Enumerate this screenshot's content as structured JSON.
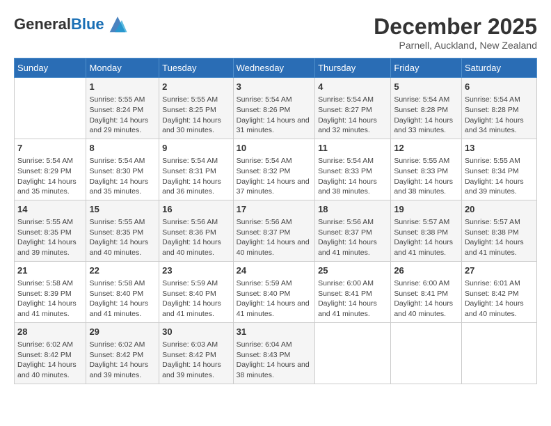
{
  "logo": {
    "general": "General",
    "blue": "Blue"
  },
  "title": {
    "month_year": "December 2025",
    "location": "Parnell, Auckland, New Zealand"
  },
  "days_header": [
    "Sunday",
    "Monday",
    "Tuesday",
    "Wednesday",
    "Thursday",
    "Friday",
    "Saturday"
  ],
  "weeks": [
    [
      {
        "day": "",
        "sunrise": "",
        "sunset": "",
        "daylight": ""
      },
      {
        "day": "1",
        "sunrise": "Sunrise: 5:55 AM",
        "sunset": "Sunset: 8:24 PM",
        "daylight": "Daylight: 14 hours and 29 minutes."
      },
      {
        "day": "2",
        "sunrise": "Sunrise: 5:55 AM",
        "sunset": "Sunset: 8:25 PM",
        "daylight": "Daylight: 14 hours and 30 minutes."
      },
      {
        "day": "3",
        "sunrise": "Sunrise: 5:54 AM",
        "sunset": "Sunset: 8:26 PM",
        "daylight": "Daylight: 14 hours and 31 minutes."
      },
      {
        "day": "4",
        "sunrise": "Sunrise: 5:54 AM",
        "sunset": "Sunset: 8:27 PM",
        "daylight": "Daylight: 14 hours and 32 minutes."
      },
      {
        "day": "5",
        "sunrise": "Sunrise: 5:54 AM",
        "sunset": "Sunset: 8:28 PM",
        "daylight": "Daylight: 14 hours and 33 minutes."
      },
      {
        "day": "6",
        "sunrise": "Sunrise: 5:54 AM",
        "sunset": "Sunset: 8:28 PM",
        "daylight": "Daylight: 14 hours and 34 minutes."
      }
    ],
    [
      {
        "day": "7",
        "sunrise": "Sunrise: 5:54 AM",
        "sunset": "Sunset: 8:29 PM",
        "daylight": "Daylight: 14 hours and 35 minutes."
      },
      {
        "day": "8",
        "sunrise": "Sunrise: 5:54 AM",
        "sunset": "Sunset: 8:30 PM",
        "daylight": "Daylight: 14 hours and 35 minutes."
      },
      {
        "day": "9",
        "sunrise": "Sunrise: 5:54 AM",
        "sunset": "Sunset: 8:31 PM",
        "daylight": "Daylight: 14 hours and 36 minutes."
      },
      {
        "day": "10",
        "sunrise": "Sunrise: 5:54 AM",
        "sunset": "Sunset: 8:32 PM",
        "daylight": "Daylight: 14 hours and 37 minutes."
      },
      {
        "day": "11",
        "sunrise": "Sunrise: 5:54 AM",
        "sunset": "Sunset: 8:33 PM",
        "daylight": "Daylight: 14 hours and 38 minutes."
      },
      {
        "day": "12",
        "sunrise": "Sunrise: 5:55 AM",
        "sunset": "Sunset: 8:33 PM",
        "daylight": "Daylight: 14 hours and 38 minutes."
      },
      {
        "day": "13",
        "sunrise": "Sunrise: 5:55 AM",
        "sunset": "Sunset: 8:34 PM",
        "daylight": "Daylight: 14 hours and 39 minutes."
      }
    ],
    [
      {
        "day": "14",
        "sunrise": "Sunrise: 5:55 AM",
        "sunset": "Sunset: 8:35 PM",
        "daylight": "Daylight: 14 hours and 39 minutes."
      },
      {
        "day": "15",
        "sunrise": "Sunrise: 5:55 AM",
        "sunset": "Sunset: 8:35 PM",
        "daylight": "Daylight: 14 hours and 40 minutes."
      },
      {
        "day": "16",
        "sunrise": "Sunrise: 5:56 AM",
        "sunset": "Sunset: 8:36 PM",
        "daylight": "Daylight: 14 hours and 40 minutes."
      },
      {
        "day": "17",
        "sunrise": "Sunrise: 5:56 AM",
        "sunset": "Sunset: 8:37 PM",
        "daylight": "Daylight: 14 hours and 40 minutes."
      },
      {
        "day": "18",
        "sunrise": "Sunrise: 5:56 AM",
        "sunset": "Sunset: 8:37 PM",
        "daylight": "Daylight: 14 hours and 41 minutes."
      },
      {
        "day": "19",
        "sunrise": "Sunrise: 5:57 AM",
        "sunset": "Sunset: 8:38 PM",
        "daylight": "Daylight: 14 hours and 41 minutes."
      },
      {
        "day": "20",
        "sunrise": "Sunrise: 5:57 AM",
        "sunset": "Sunset: 8:38 PM",
        "daylight": "Daylight: 14 hours and 41 minutes."
      }
    ],
    [
      {
        "day": "21",
        "sunrise": "Sunrise: 5:58 AM",
        "sunset": "Sunset: 8:39 PM",
        "daylight": "Daylight: 14 hours and 41 minutes."
      },
      {
        "day": "22",
        "sunrise": "Sunrise: 5:58 AM",
        "sunset": "Sunset: 8:40 PM",
        "daylight": "Daylight: 14 hours and 41 minutes."
      },
      {
        "day": "23",
        "sunrise": "Sunrise: 5:59 AM",
        "sunset": "Sunset: 8:40 PM",
        "daylight": "Daylight: 14 hours and 41 minutes."
      },
      {
        "day": "24",
        "sunrise": "Sunrise: 5:59 AM",
        "sunset": "Sunset: 8:40 PM",
        "daylight": "Daylight: 14 hours and 41 minutes."
      },
      {
        "day": "25",
        "sunrise": "Sunrise: 6:00 AM",
        "sunset": "Sunset: 8:41 PM",
        "daylight": "Daylight: 14 hours and 41 minutes."
      },
      {
        "day": "26",
        "sunrise": "Sunrise: 6:00 AM",
        "sunset": "Sunset: 8:41 PM",
        "daylight": "Daylight: 14 hours and 40 minutes."
      },
      {
        "day": "27",
        "sunrise": "Sunrise: 6:01 AM",
        "sunset": "Sunset: 8:42 PM",
        "daylight": "Daylight: 14 hours and 40 minutes."
      }
    ],
    [
      {
        "day": "28",
        "sunrise": "Sunrise: 6:02 AM",
        "sunset": "Sunset: 8:42 PM",
        "daylight": "Daylight: 14 hours and 40 minutes."
      },
      {
        "day": "29",
        "sunrise": "Sunrise: 6:02 AM",
        "sunset": "Sunset: 8:42 PM",
        "daylight": "Daylight: 14 hours and 39 minutes."
      },
      {
        "day": "30",
        "sunrise": "Sunrise: 6:03 AM",
        "sunset": "Sunset: 8:42 PM",
        "daylight": "Daylight: 14 hours and 39 minutes."
      },
      {
        "day": "31",
        "sunrise": "Sunrise: 6:04 AM",
        "sunset": "Sunset: 8:43 PM",
        "daylight": "Daylight: 14 hours and 38 minutes."
      },
      {
        "day": "",
        "sunrise": "",
        "sunset": "",
        "daylight": ""
      },
      {
        "day": "",
        "sunrise": "",
        "sunset": "",
        "daylight": ""
      },
      {
        "day": "",
        "sunrise": "",
        "sunset": "",
        "daylight": ""
      }
    ]
  ]
}
